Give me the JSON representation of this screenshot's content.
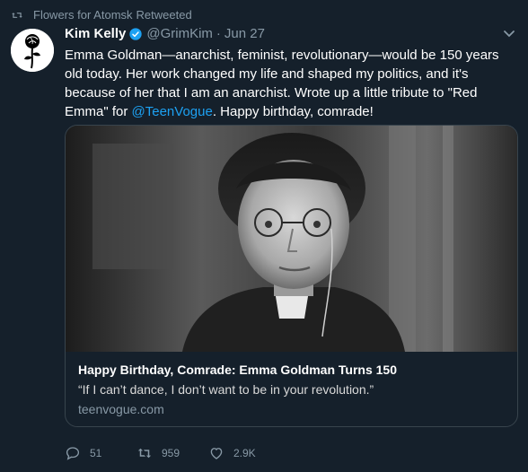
{
  "retweet_context": {
    "retweeter": "Flowers for Atomsk",
    "label": "Retweeted"
  },
  "tweet": {
    "author_name": "Kim Kelly",
    "author_handle": "@GrimKim",
    "separator": "·",
    "date": "Jun 27",
    "text_before_mention": "Emma Goldman—anarchist, feminist, revolutionary—would be 150 years old today. Her work changed my life and shaped my politics, and it's because of her that I am an anarchist. Wrote up a little tribute to \"Red Emma\" for ",
    "mention": "@TeenVogue",
    "text_after_mention": ". Happy birthday, comrade!"
  },
  "card": {
    "title": "Happy Birthday, Comrade: Emma Goldman Turns 150",
    "description": "“If I can’t dance, I don’t want to be in your revolution.”",
    "domain": "teenvogue.com"
  },
  "actions": {
    "replies": "51",
    "retweets": "959",
    "likes": "2.9K"
  },
  "colors": {
    "background": "#15202b",
    "link": "#1da1f2",
    "secondary_text": "#8899a6",
    "border": "#38444d"
  },
  "icons": [
    "retweet-icon",
    "verified-badge-icon",
    "caret-down-icon",
    "reply-icon",
    "like-icon"
  ]
}
